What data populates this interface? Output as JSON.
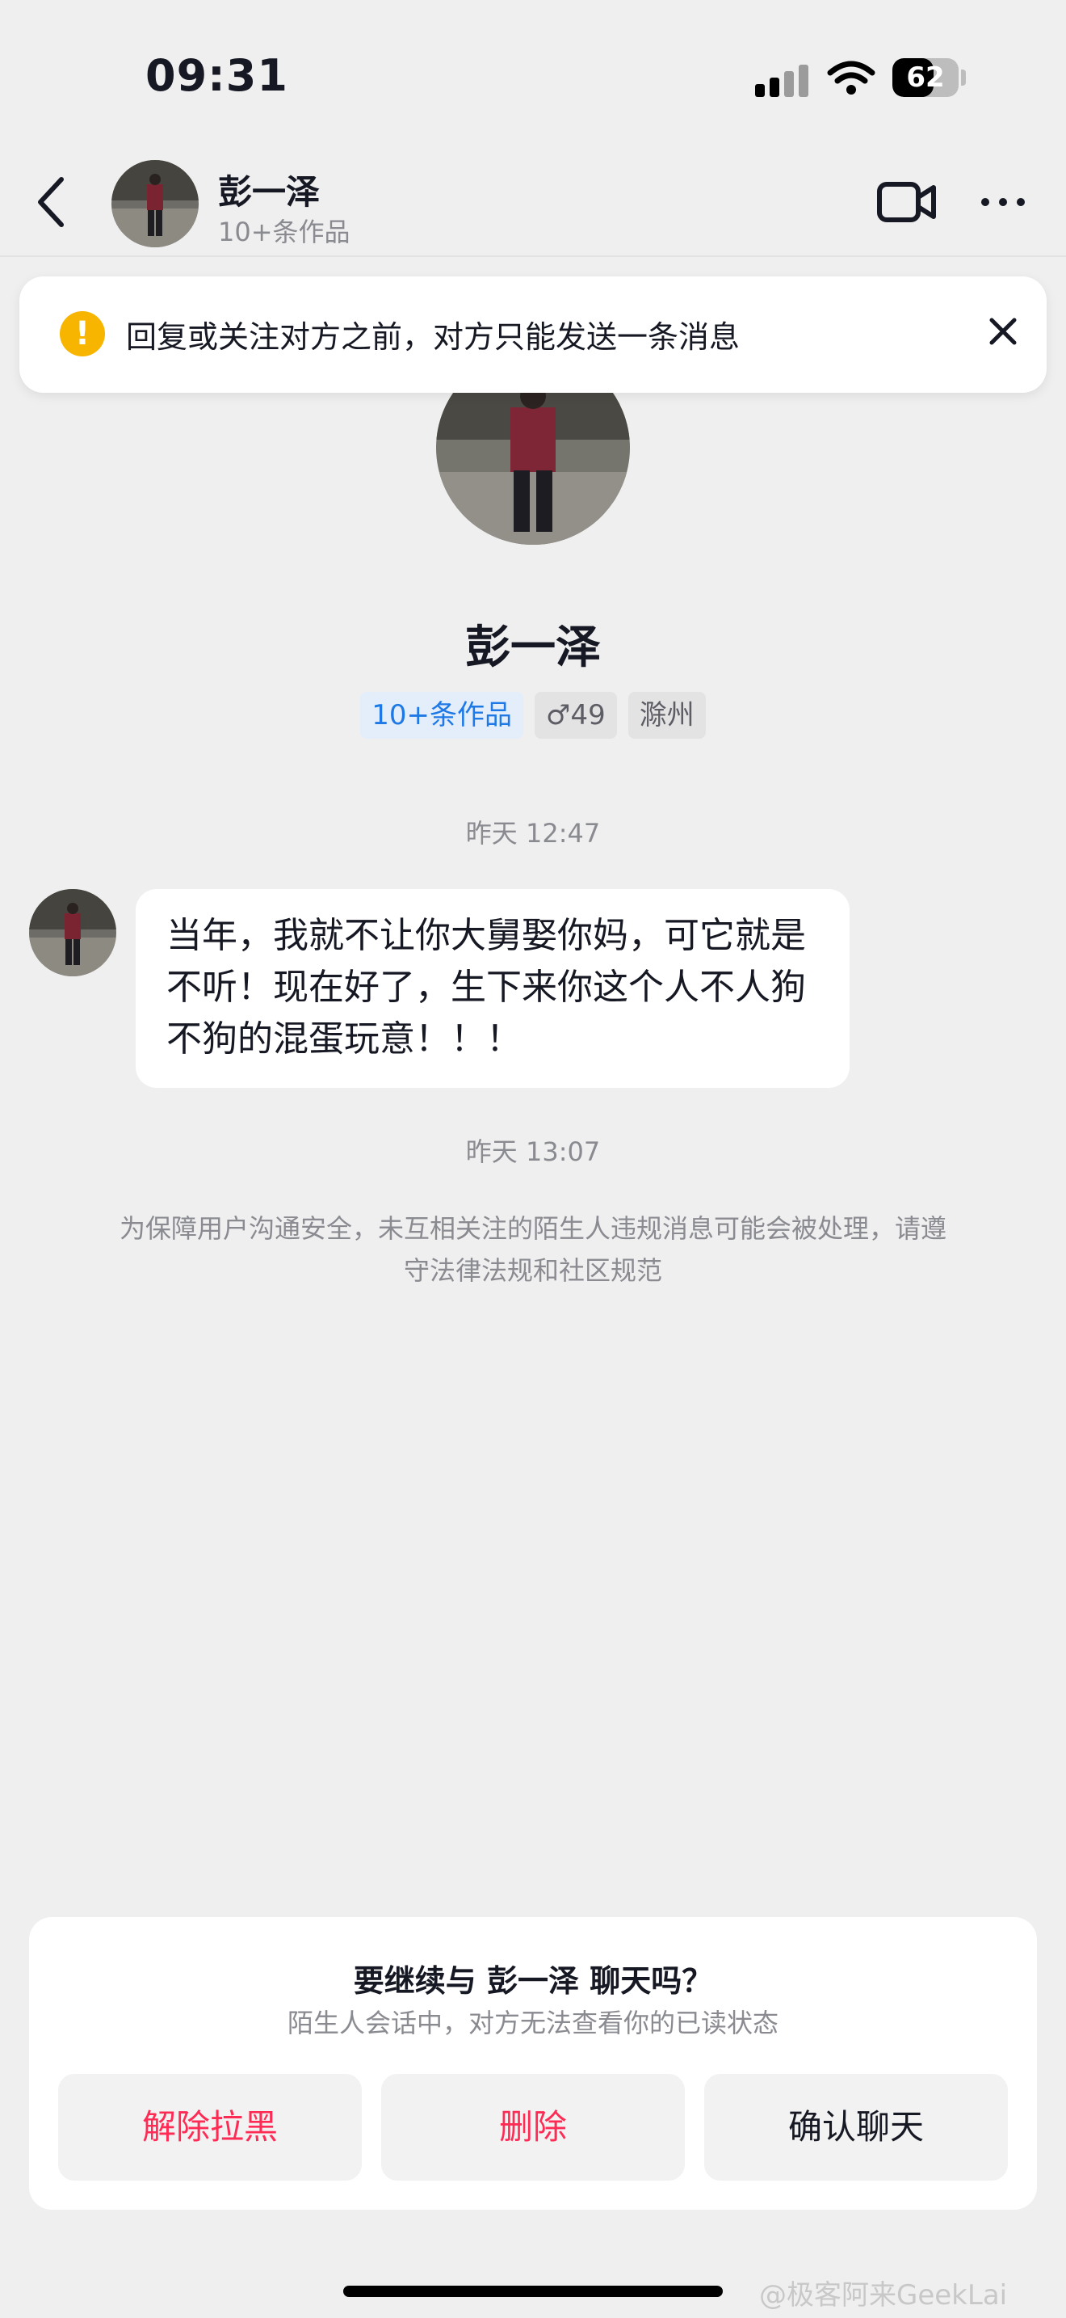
{
  "status_bar": {
    "time": "09:31",
    "battery": "62",
    "battery_level": 0.62
  },
  "header": {
    "name": "彭一泽",
    "subtitle": "10+条作品"
  },
  "notice": {
    "text": "回复或关注对方之前，对方只能发送一条消息"
  },
  "profile": {
    "name": "彭一泽",
    "tags": {
      "works": "10+条作品",
      "gender_age": "♂49",
      "location": "滁州"
    }
  },
  "chat": {
    "timestamp_1": "昨天 12:47",
    "message": "当年，我就不让你大舅娶你妈，可它就是不听！现在好了，生下来你这个人不人狗不狗的混蛋玩意！！！",
    "timestamp_2": "昨天 13:07",
    "safety_notice": "为保障用户沟通安全，未互相关注的陌生人违规消息可能会被处理，请遵守法律法规和社区规范"
  },
  "bottom_card": {
    "title": "要继续与 彭一泽 聊天吗？",
    "subtitle": "陌生人会话中，对方无法查看你的已读状态",
    "buttons": {
      "unblock": "解除拉黑",
      "delete": "删除",
      "confirm": "确认聊天"
    }
  },
  "watermark": "@极客阿来GeekLai",
  "colors": {
    "accent_red": "#fe2c55",
    "works_blue": "#1e79e6",
    "warning": "#f7b500",
    "background": "#efefef"
  },
  "icons": [
    "back-icon",
    "video-call-icon",
    "more-icon",
    "warning-icon",
    "close-icon",
    "signal-icon",
    "wifi-icon",
    "battery-icon"
  ]
}
